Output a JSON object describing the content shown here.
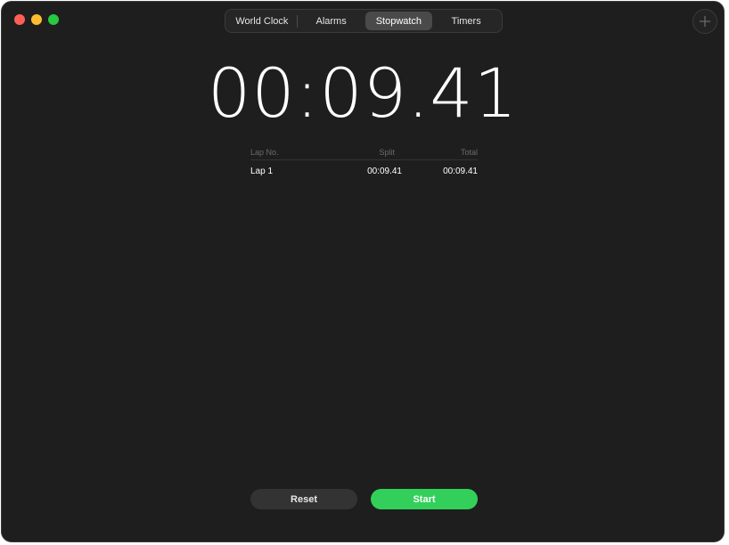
{
  "window": {
    "controls": {
      "close_color": "#ff5f57",
      "minimize_color": "#febc2e",
      "zoom_color": "#28c840"
    }
  },
  "tabs": [
    {
      "label": "World Clock",
      "selected": false
    },
    {
      "label": "Alarms",
      "selected": false
    },
    {
      "label": "Stopwatch",
      "selected": true
    },
    {
      "label": "Timers",
      "selected": false
    }
  ],
  "toolbar": {
    "add_icon": "plus-icon"
  },
  "stopwatch": {
    "display_time": "00:09.41",
    "lap_table": {
      "headers": [
        "Lap No.",
        "Split",
        "Total"
      ],
      "rows": [
        {
          "lap": "Lap 1",
          "split": "00:09.41",
          "total": "00:09.41"
        }
      ]
    },
    "reset_label": "Reset",
    "start_label": "Start",
    "start_color": "#32d05a"
  }
}
